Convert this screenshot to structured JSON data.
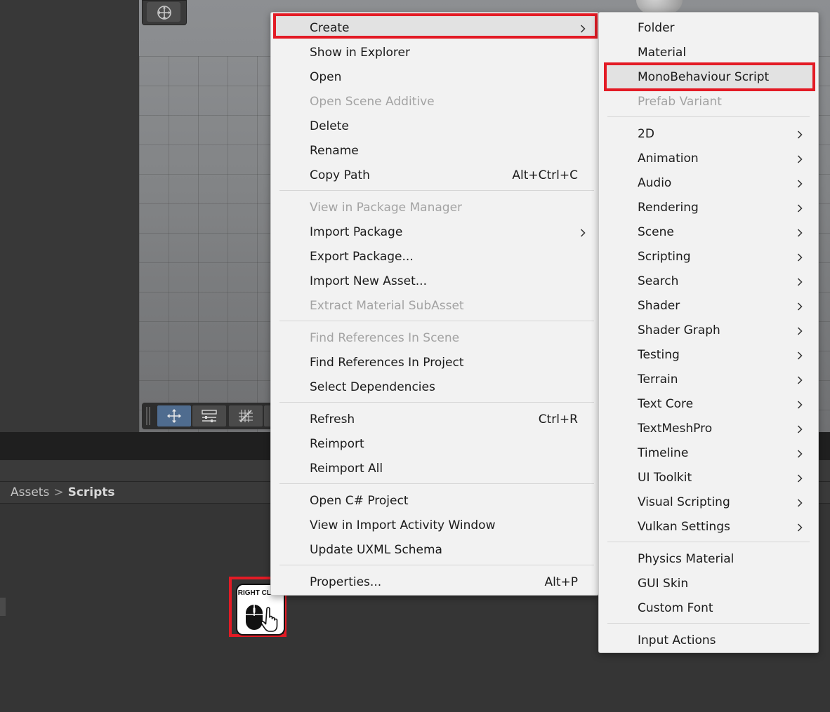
{
  "breadcrumb": {
    "root": "Assets",
    "separator": ">",
    "current": "Scripts"
  },
  "badge": {
    "text": "RIGHT CLICK"
  },
  "highlight_color": "#e31b25",
  "icons": {
    "gizmo": "move-gizmo-icon",
    "toolbar": [
      "move-tool-icon",
      "settings-sliders-icon",
      "grid-snap-icon"
    ],
    "submenu_arrow": "chevron-right-icon",
    "mouse": "mouse-right-click-icon"
  },
  "main_menu": {
    "items": [
      {
        "label": "Create",
        "shortcut": "",
        "disabled": false,
        "submenu": true,
        "highlighted": true
      },
      {
        "label": "Show in Explorer",
        "shortcut": "",
        "disabled": false,
        "submenu": false
      },
      {
        "label": "Open",
        "shortcut": "",
        "disabled": false,
        "submenu": false
      },
      {
        "label": "Open Scene Additive",
        "shortcut": "",
        "disabled": true,
        "submenu": false
      },
      {
        "label": "Delete",
        "shortcut": "",
        "disabled": false,
        "submenu": false
      },
      {
        "label": "Rename",
        "shortcut": "",
        "disabled": false,
        "submenu": false
      },
      {
        "label": "Copy Path",
        "shortcut": "Alt+Ctrl+C",
        "disabled": false,
        "submenu": false
      },
      {
        "label": "View in Package Manager",
        "shortcut": "",
        "disabled": true,
        "submenu": false
      },
      {
        "label": "Import Package",
        "shortcut": "",
        "disabled": false,
        "submenu": true
      },
      {
        "label": "Export Package...",
        "shortcut": "",
        "disabled": false,
        "submenu": false
      },
      {
        "label": "Import New Asset...",
        "shortcut": "",
        "disabled": false,
        "submenu": false
      },
      {
        "label": "Extract Material SubAsset",
        "shortcut": "",
        "disabled": true,
        "submenu": false
      },
      {
        "label": "Find References In Scene",
        "shortcut": "",
        "disabled": true,
        "submenu": false
      },
      {
        "label": "Find References In Project",
        "shortcut": "",
        "disabled": false,
        "submenu": false
      },
      {
        "label": "Select Dependencies",
        "shortcut": "",
        "disabled": false,
        "submenu": false
      },
      {
        "label": "Refresh",
        "shortcut": "Ctrl+R",
        "disabled": false,
        "submenu": false
      },
      {
        "label": "Reimport",
        "shortcut": "",
        "disabled": false,
        "submenu": false
      },
      {
        "label": "Reimport All",
        "shortcut": "",
        "disabled": false,
        "submenu": false
      },
      {
        "label": "Open C# Project",
        "shortcut": "",
        "disabled": false,
        "submenu": false
      },
      {
        "label": "View in Import Activity Window",
        "shortcut": "",
        "disabled": false,
        "submenu": false
      },
      {
        "label": "Update UXML Schema",
        "shortcut": "",
        "disabled": false,
        "submenu": false
      },
      {
        "label": "Properties...",
        "shortcut": "Alt+P",
        "disabled": false,
        "submenu": false
      }
    ]
  },
  "create_submenu": {
    "items": [
      {
        "label": "Folder",
        "disabled": false,
        "submenu": false
      },
      {
        "label": "Material",
        "disabled": false,
        "submenu": false
      },
      {
        "label": "MonoBehaviour Script",
        "disabled": false,
        "submenu": false,
        "highlighted": true
      },
      {
        "label": "Prefab Variant",
        "disabled": true,
        "submenu": false
      },
      {
        "label": "2D",
        "disabled": false,
        "submenu": true
      },
      {
        "label": "Animation",
        "disabled": false,
        "submenu": true
      },
      {
        "label": "Audio",
        "disabled": false,
        "submenu": true
      },
      {
        "label": "Rendering",
        "disabled": false,
        "submenu": true
      },
      {
        "label": "Scene",
        "disabled": false,
        "submenu": true
      },
      {
        "label": "Scripting",
        "disabled": false,
        "submenu": true
      },
      {
        "label": "Search",
        "disabled": false,
        "submenu": true
      },
      {
        "label": "Shader",
        "disabled": false,
        "submenu": true
      },
      {
        "label": "Shader Graph",
        "disabled": false,
        "submenu": true
      },
      {
        "label": "Testing",
        "disabled": false,
        "submenu": true
      },
      {
        "label": "Terrain",
        "disabled": false,
        "submenu": true
      },
      {
        "label": "Text Core",
        "disabled": false,
        "submenu": true
      },
      {
        "label": "TextMeshPro",
        "disabled": false,
        "submenu": true
      },
      {
        "label": "Timeline",
        "disabled": false,
        "submenu": true
      },
      {
        "label": "UI Toolkit",
        "disabled": false,
        "submenu": true
      },
      {
        "label": "Visual Scripting",
        "disabled": false,
        "submenu": true
      },
      {
        "label": "Vulkan Settings",
        "disabled": false,
        "submenu": true
      },
      {
        "label": "Physics Material",
        "disabled": false,
        "submenu": false
      },
      {
        "label": "GUI Skin",
        "disabled": false,
        "submenu": false
      },
      {
        "label": "Custom Font",
        "disabled": false,
        "submenu": false
      },
      {
        "label": "Input Actions",
        "disabled": false,
        "submenu": false
      }
    ]
  }
}
